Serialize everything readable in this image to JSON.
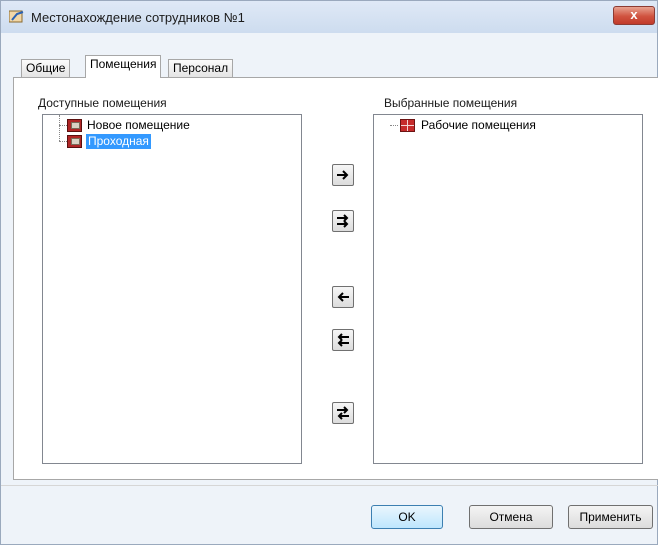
{
  "window": {
    "title": "Местонахождение сотрудников №1",
    "close_label": "x"
  },
  "tabs": [
    {
      "label": "Общие",
      "active": false
    },
    {
      "label": "Помещения",
      "active": true
    },
    {
      "label": "Персонал",
      "active": false
    }
  ],
  "available": {
    "caption": "Доступные помещения",
    "items": [
      {
        "label": "Новое помещение",
        "selected": false,
        "icon": "room-icon"
      },
      {
        "label": "Проходная",
        "selected": true,
        "icon": "room-icon"
      }
    ]
  },
  "selected": {
    "caption": "Выбранные помещения",
    "items": [
      {
        "label": "Рабочие помещения",
        "icon": "room-group-icon"
      }
    ]
  },
  "transfer_buttons": [
    {
      "name": "add-one-button",
      "icon": "arrow-right-icon"
    },
    {
      "name": "add-all-button",
      "icon": "double-arrow-right-icon"
    },
    {
      "name": "remove-one-button",
      "icon": "arrow-left-icon"
    },
    {
      "name": "remove-all-button",
      "icon": "double-arrow-left-icon"
    },
    {
      "name": "swap-button",
      "icon": "swap-arrows-icon"
    }
  ],
  "footer": {
    "ok_label": "OK",
    "cancel_label": "Отмена",
    "apply_label": "Применить"
  },
  "colors": {
    "selection": "#3399ff",
    "room_icon": "#b02626",
    "default_button_border": "#3c7fb1"
  }
}
